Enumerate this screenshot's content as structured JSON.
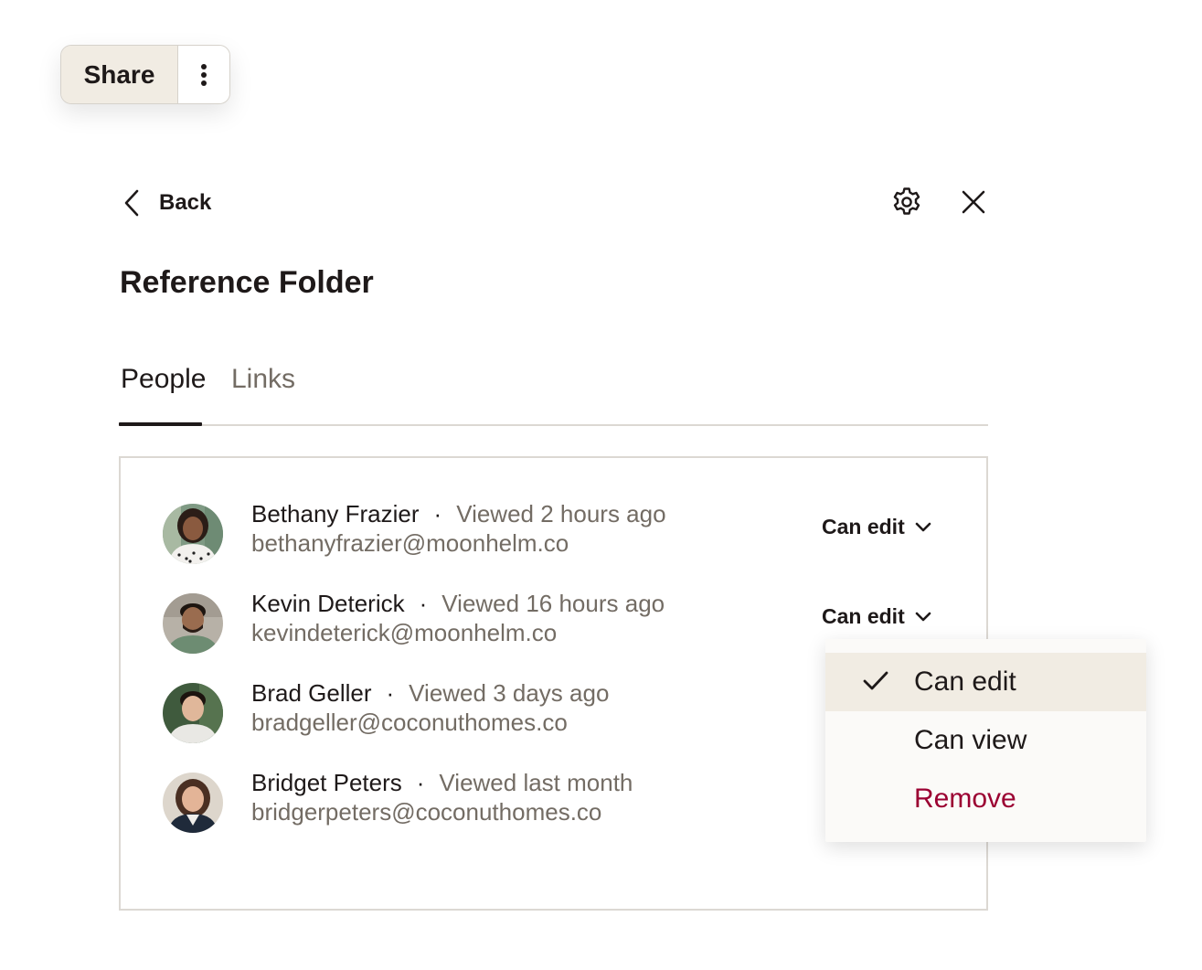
{
  "share": {
    "label": "Share"
  },
  "header": {
    "back_label": "Back",
    "title": "Reference Folder"
  },
  "tabs": [
    {
      "label": "People",
      "active": true
    },
    {
      "label": "Links",
      "active": false
    }
  ],
  "people": [
    {
      "name": "Bethany Frazier",
      "separator": "·",
      "viewed": "Viewed 2 hours ago",
      "email": "bethanyfrazier@moonhelm.co",
      "permission": "Can edit"
    },
    {
      "name": "Kevin Deterick",
      "separator": "·",
      "viewed": "Viewed 16 hours ago",
      "email": "kevindeterick@moonhelm.co",
      "permission": "Can edit"
    },
    {
      "name": "Brad Geller",
      "separator": "·",
      "viewed": "Viewed 3 days ago",
      "email": "bradgeller@coconuthomes.co"
    },
    {
      "name": "Bridget Peters",
      "separator": "·",
      "viewed": "Viewed last month",
      "email": "bridgerpeters@coconuthomes.co"
    }
  ],
  "permission_menu": {
    "items": [
      {
        "label": "Can edit",
        "selected": true
      },
      {
        "label": "Can view",
        "selected": false
      },
      {
        "label": "Remove",
        "selected": false,
        "destructive": true
      }
    ]
  },
  "colors": {
    "text_primary": "#1e1919",
    "text_secondary": "#736c64",
    "highlight": "#f1ece3",
    "destructive": "#9b0032",
    "border": "#dcd8d3"
  },
  "icons": {
    "more": "vertical-dots-icon",
    "back": "chevron-left-icon",
    "settings": "gear-icon",
    "close": "close-icon",
    "dropdown": "chevron-down-icon",
    "check": "checkmark-icon"
  }
}
